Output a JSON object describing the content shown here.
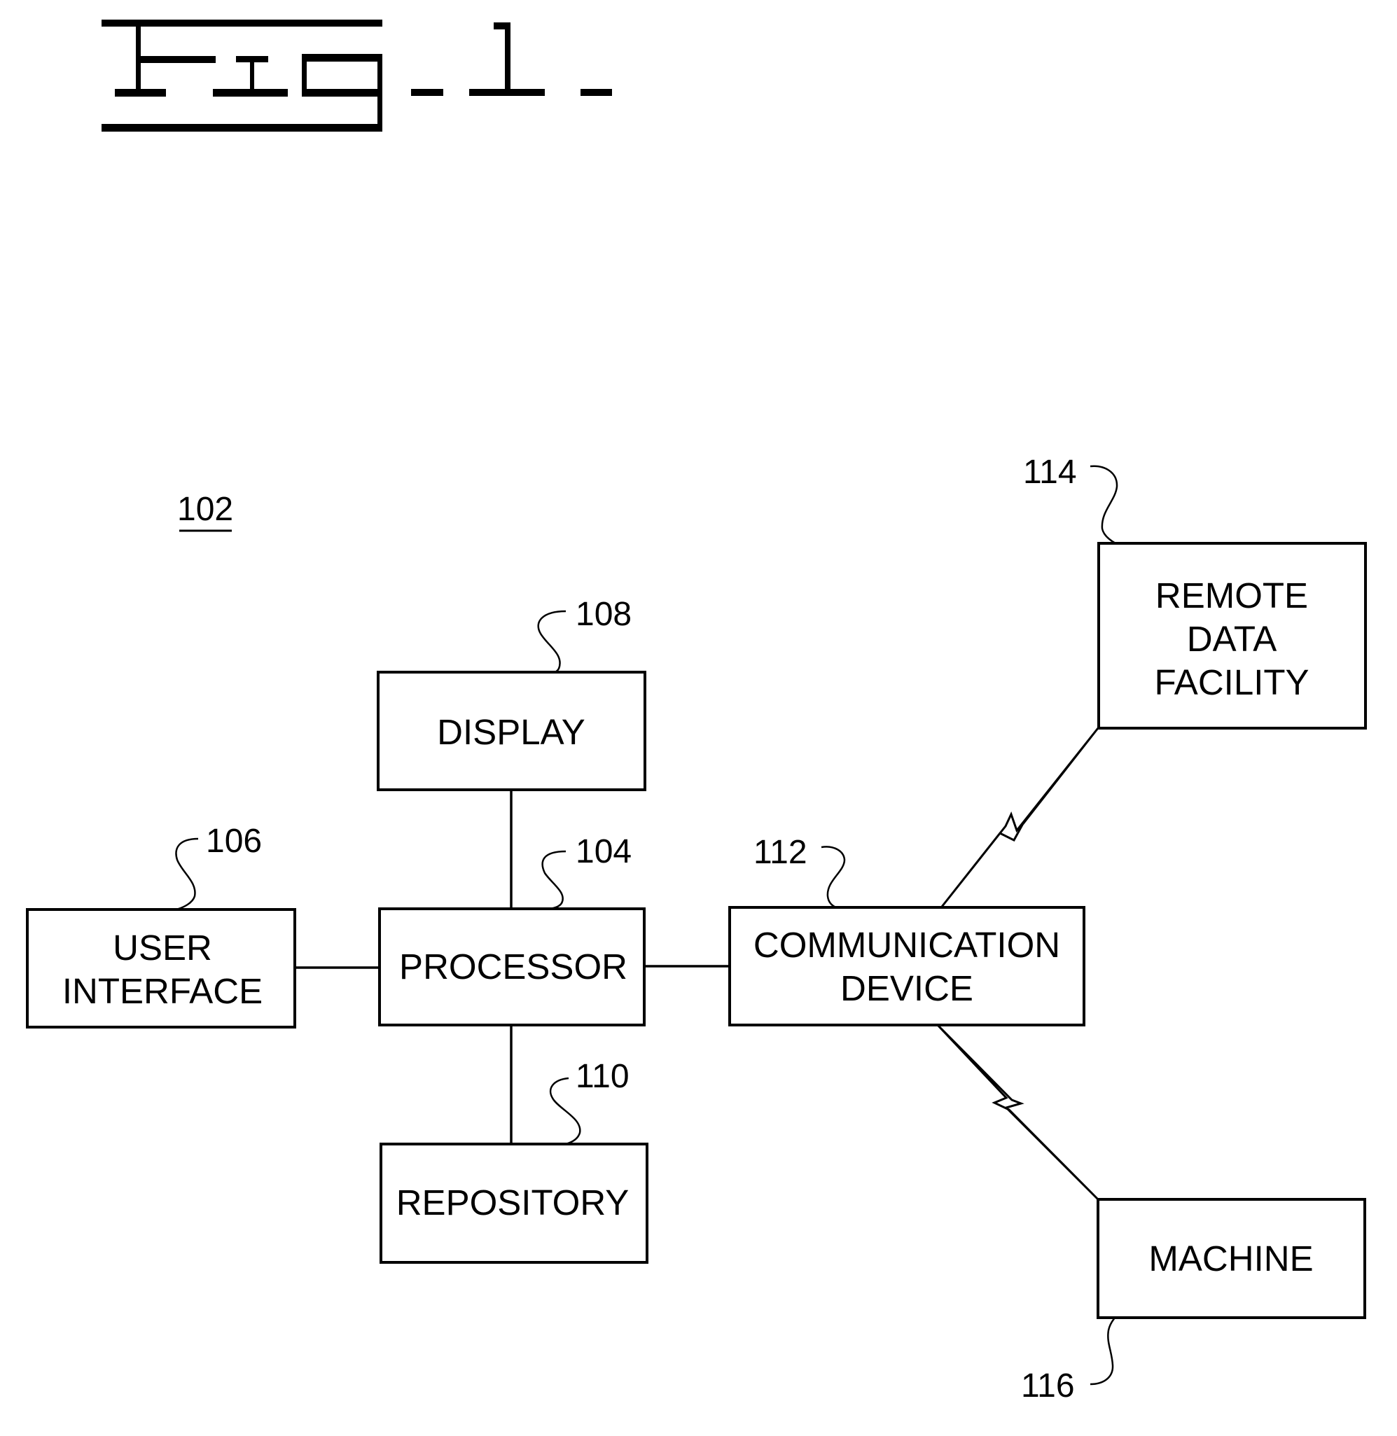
{
  "figure": {
    "title": "Fig. 1.",
    "system_ref": "102"
  },
  "blocks": {
    "processor": {
      "ref": "104",
      "lines": [
        "PROCESSOR"
      ]
    },
    "user_interface": {
      "ref": "106",
      "lines": [
        "USER",
        "INTERFACE"
      ]
    },
    "display": {
      "ref": "108",
      "lines": [
        "DISPLAY"
      ]
    },
    "repository": {
      "ref": "110",
      "lines": [
        "REPOSITORY"
      ]
    },
    "communication_device": {
      "ref": "112",
      "lines": [
        "COMMUNICATION",
        "DEVICE"
      ]
    },
    "remote_data_facility": {
      "ref": "114",
      "lines": [
        "REMOTE",
        "DATA",
        "FACILITY"
      ]
    },
    "machine": {
      "ref": "116",
      "lines": [
        "MACHINE"
      ]
    }
  },
  "connections": [
    {
      "from": "processor",
      "to": "display",
      "kind": "wired"
    },
    {
      "from": "processor",
      "to": "user_interface",
      "kind": "wired"
    },
    {
      "from": "processor",
      "to": "repository",
      "kind": "wired"
    },
    {
      "from": "processor",
      "to": "communication_device",
      "kind": "wired"
    },
    {
      "from": "communication_device",
      "to": "remote_data_facility",
      "kind": "wireless"
    },
    {
      "from": "communication_device",
      "to": "machine",
      "kind": "wireless"
    }
  ],
  "colors": {
    "ink": "#000000",
    "paper": "#ffffff"
  }
}
